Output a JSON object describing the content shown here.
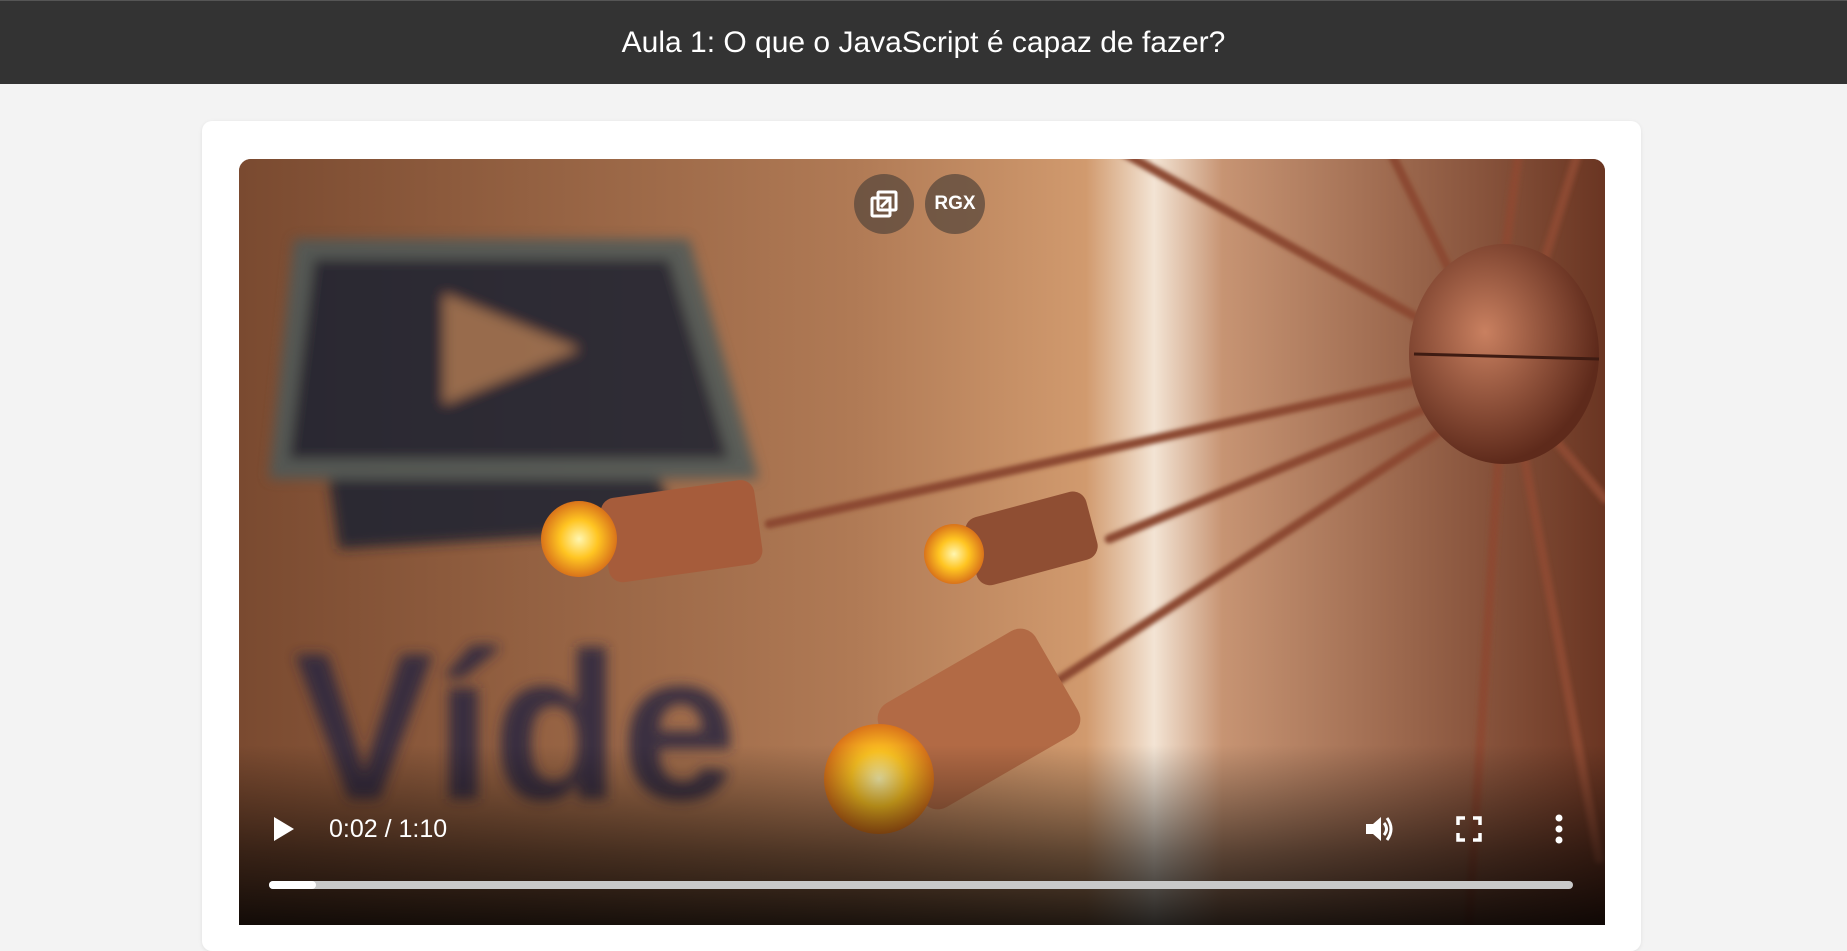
{
  "header": {
    "title": "Aula 1: O que o JavaScript é capaz de fazer?"
  },
  "video": {
    "pip_icon": "picture-in-picture-icon",
    "rgx_label": "RGX",
    "current_time": "0:02",
    "duration": "1:10",
    "time_display": "0:02 / 1:10",
    "progress": 0.036,
    "play_icon": "play-icon",
    "volume_icon": "volume-icon",
    "fullscreen_icon": "fullscreen-icon",
    "more_icon": "more-options-icon"
  },
  "colors": {
    "header_bg": "#333333",
    "page_bg": "#f3f3f3",
    "card_bg": "#ffffff"
  }
}
